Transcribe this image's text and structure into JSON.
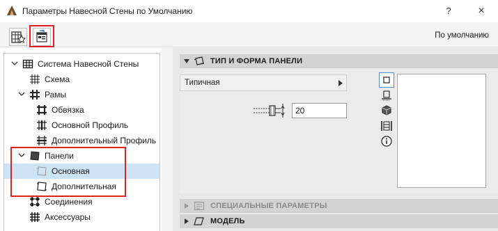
{
  "window": {
    "title": "Параметры Навесной Стены по Умолчанию",
    "help": "?",
    "close": "×"
  },
  "toolbar": {
    "default_label": "По умолчанию"
  },
  "tree": {
    "items": [
      {
        "label": "Система Навесной Стены",
        "expanded": true,
        "level": 0,
        "icon": "curtain-wall-system-icon"
      },
      {
        "label": "Схема",
        "level": 1,
        "icon": "scheme-grid-icon"
      },
      {
        "label": "Рамы",
        "expanded": true,
        "level": 1,
        "icon": "frames-icon"
      },
      {
        "label": "Обвязка",
        "level": 2,
        "icon": "boundary-frame-icon"
      },
      {
        "label": "Основной Профиль",
        "level": 2,
        "icon": "main-frame-icon"
      },
      {
        "label": "Дополнительный Профиль",
        "level": 2,
        "icon": "extra-frame-icon"
      },
      {
        "label": "Панели",
        "expanded": true,
        "level": 1,
        "icon": "panels-icon"
      },
      {
        "label": "Основная",
        "level": 2,
        "icon": "main-panel-icon",
        "selected": true
      },
      {
        "label": "Дополнительная",
        "level": 2,
        "icon": "extra-panel-icon"
      },
      {
        "label": "Соединения",
        "level": 1,
        "icon": "junctions-icon"
      },
      {
        "label": "Аксессуары",
        "level": 1,
        "icon": "accessories-icon"
      }
    ]
  },
  "sections": {
    "panel_type": {
      "title": "ТИП И ФОРМА ПАНЕЛИ",
      "expanded": true
    },
    "special": {
      "title": "СПЕЦИАЛЬНЫЕ ПАРАМЕТРЫ",
      "expanded": false,
      "disabled": true
    },
    "model": {
      "title": "МОДЕЛЬ",
      "expanded": false
    }
  },
  "panel_type": {
    "selector_value": "Типичная",
    "thickness_value": "20"
  },
  "view_tabs": [
    "plan-view-icon",
    "section-view-icon",
    "3d-view-icon",
    "list-view-icon",
    "info-icon"
  ],
  "colors": {
    "highlight": "#e31e24",
    "selection": "#cde4f7",
    "active_tab_border": "#4d8fd4"
  }
}
